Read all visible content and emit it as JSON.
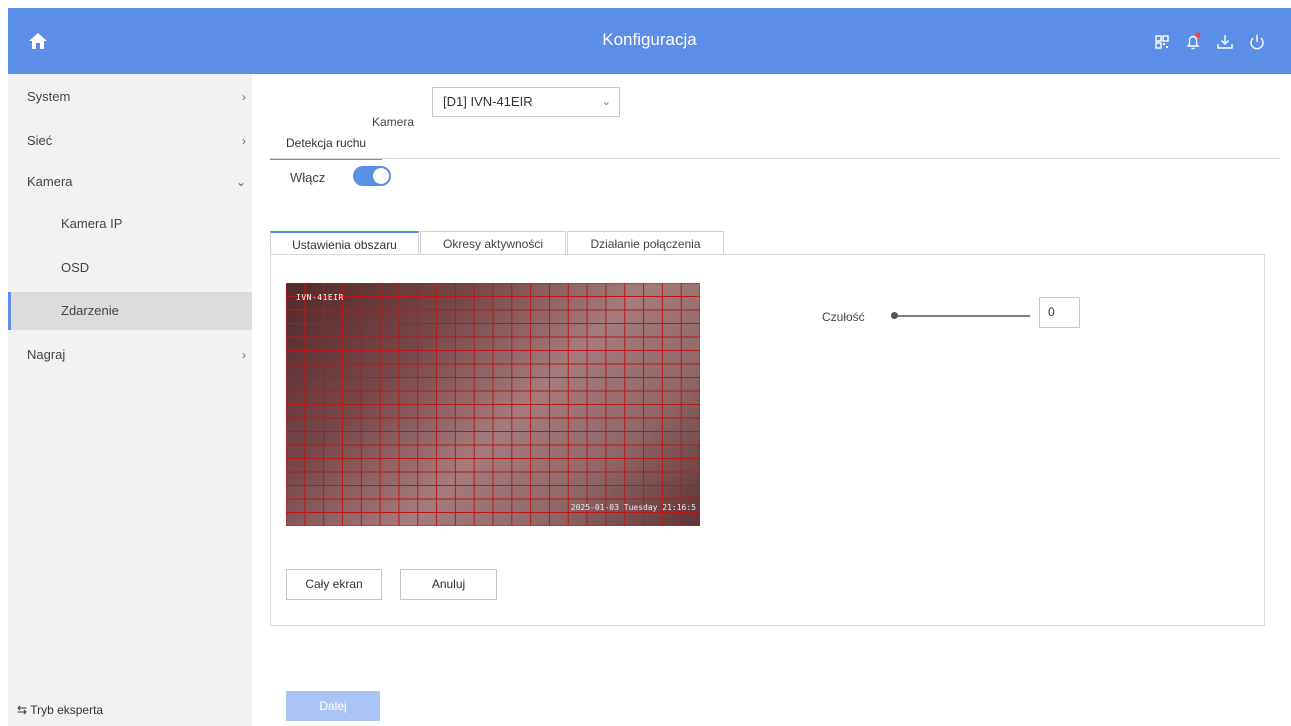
{
  "header": {
    "title": "Konfiguracja",
    "bg_color": "#5b8ee6",
    "left_icon": "home-icon",
    "right_icons": [
      "qr-code-icon",
      "bell-icon",
      "download-icon",
      "power-icon"
    ],
    "notification_dot_color": "#ff3b3b"
  },
  "sidebar": {
    "items": [
      {
        "label": "System",
        "chevron": "›"
      },
      {
        "label": "Sieć",
        "chevron": "›"
      },
      {
        "label": "Kamera",
        "chevron": "⌄"
      },
      {
        "label": "Kamera IP"
      },
      {
        "label": "OSD"
      },
      {
        "label": "Zdarzenie"
      },
      {
        "label": "Nagraj",
        "chevron": "›"
      }
    ],
    "active_item": "Zdarzenie",
    "expert_mode": {
      "icon": "⇆",
      "label": "Tryb eksperta"
    }
  },
  "camera": {
    "label": "Kamera",
    "selected": "[D1] IVN-41EIR",
    "chevron": "⌄"
  },
  "section": {
    "title": "Detekcja ruchu",
    "enable_label": "Włącz",
    "enabled": true
  },
  "tabs": [
    {
      "label": "Ustawienia obszaru",
      "active": true
    },
    {
      "label": "Okresy aktywności",
      "active": false
    },
    {
      "label": "Działanie połączenia",
      "active": false
    }
  ],
  "preview": {
    "camera_name": "IVN-41EIR",
    "timestamp": "2025-01-03 Tuesday 21:16:5",
    "grid_color": "#b81818"
  },
  "sensitivity": {
    "label": "Czułość",
    "value": "0"
  },
  "buttons": {
    "full_screen": "Cały ekran",
    "cancel": "Anuluj",
    "next": "Dalej"
  }
}
